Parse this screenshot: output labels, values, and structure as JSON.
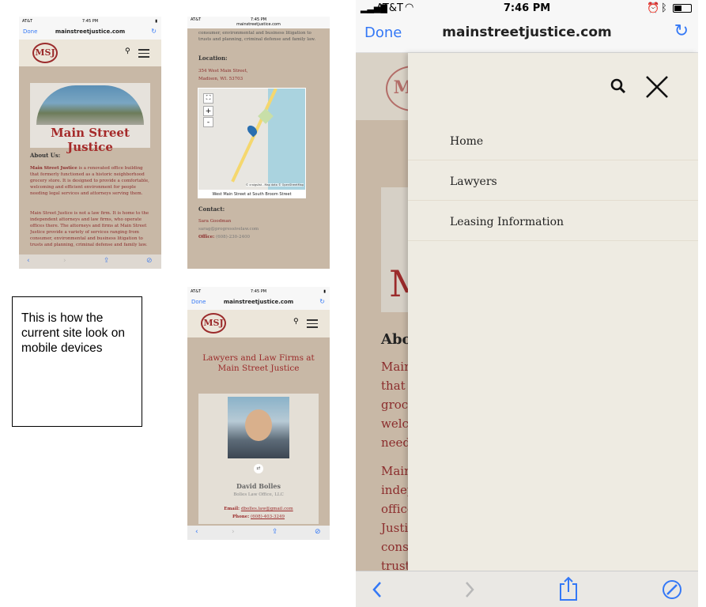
{
  "status": {
    "carrier": "AT&T",
    "time_small": "7:45 PM",
    "time_big": "7:46 PM"
  },
  "browser": {
    "done": "Done",
    "url": "mainstreetjustice.com",
    "refresh": "↻"
  },
  "logo": "MSJ",
  "site_title": "Main Street Justice",
  "about": {
    "heading": "About Us:",
    "p1_bold": "Main Street Justice",
    "p1": "is a renovated office building that formerly functioned as a historic neighborhood grocery store. It is designed to provide a comfortable, welcoming and efficient environment for people needing legal services and attorneys serving them.",
    "p2": "Main Street Justice is not a law firm. It is home to the independent attorneys and law firms, who operate offices there. The attorneys and firms at Main Street Justice provide a variety of services ranging from consumer, environmental and business litigation to trusts and planning, criminal defense and family law."
  },
  "location": {
    "top_text": "consumer, environmental and business litigation to trusts and planning, criminal defense and family law.",
    "heading": "Location:",
    "addr1": "354 West Main Street,",
    "addr2": "Madison, WI. 53703",
    "map_credit": "© craigslist - Map data © OpenStreetMap",
    "map_caption": "West Main Street at South Broom Street"
  },
  "contact": {
    "heading": "Contact:",
    "name": "Sara Goodman",
    "email": "sarag@progressivelaw.com",
    "office_label": "Office:",
    "office": "(608)-230-2400"
  },
  "lawyers": {
    "heading": "Lawyers and Law Firms at Main Street Justice",
    "name": "David Bolles",
    "firm": "Bolles Law Office, LLC",
    "email_label": "Email:",
    "email": "dbolles.law@gmail.com",
    "phone_label": "Phone:",
    "phone": "(608)-403-3249"
  },
  "note": "This is how the current site look on mobile devices",
  "menu": {
    "items": [
      "Home",
      "Lawyers",
      "Leasing Information"
    ]
  },
  "bg_text": [
    "Abo",
    "Main",
    "that f",
    "groce",
    "welco",
    "needi",
    "Main",
    "indep",
    "office",
    "Justic",
    "consu",
    "trust"
  ]
}
